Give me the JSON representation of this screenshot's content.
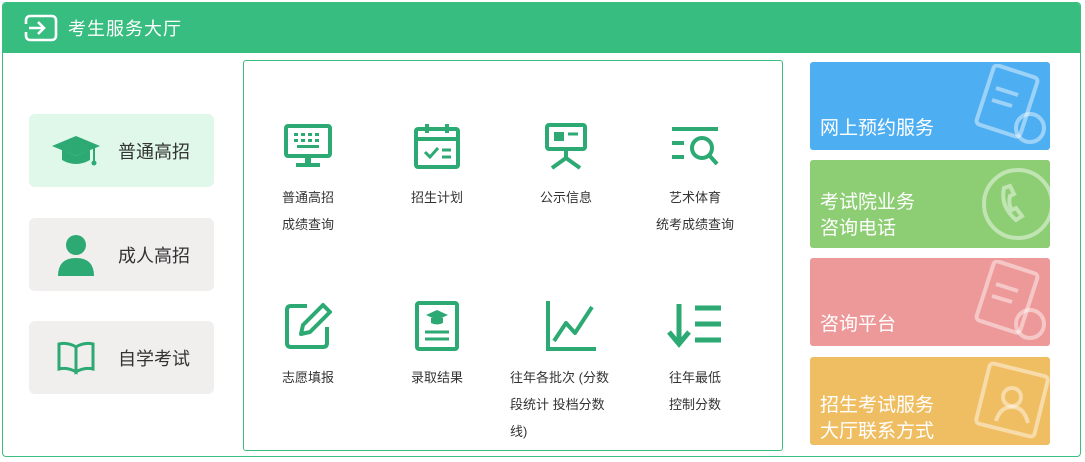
{
  "header": {
    "title": "考生服务大厅",
    "icon": "exit-icon"
  },
  "sidebar": {
    "items": [
      {
        "label": "普通高招",
        "icon": "graduation-cap-icon",
        "active": true
      },
      {
        "label": "成人高招",
        "icon": "person-icon",
        "active": false
      },
      {
        "label": "自学考试",
        "icon": "book-icon",
        "active": false
      }
    ]
  },
  "services": [
    {
      "line1": "普通高招",
      "line2": "成绩查询",
      "icon": "monitor-keyboard-icon"
    },
    {
      "line1": "招生计划",
      "line2": "",
      "icon": "calendar-check-icon"
    },
    {
      "line1": "公示信息",
      "line2": "",
      "icon": "presentation-board-icon"
    },
    {
      "line1": "艺术体育",
      "line2": "统考成绩查询",
      "icon": "list-search-icon"
    },
    {
      "line1": "志愿填报",
      "line2": "",
      "icon": "edit-form-icon"
    },
    {
      "line1": "录取结果",
      "line2": "",
      "icon": "certificate-icon"
    },
    {
      "line1": "往年各批次 (分数",
      "line2": "段统计 投档分数",
      "line3": "线)",
      "icon": "line-chart-icon"
    },
    {
      "line1": "往年最低",
      "line2": "控制分数",
      "icon": "sort-down-list-icon"
    }
  ],
  "cards": [
    {
      "line1": "网上预约服务",
      "line2": "",
      "color": "#4eaef2",
      "icon": "document-search-icon"
    },
    {
      "line1": "考试院业务",
      "line2": "咨询电话",
      "color": "#8dce74",
      "icon": "phone-icon"
    },
    {
      "line1": "咨询平台",
      "line2": "",
      "color": "#ee9999",
      "icon": "document-search-icon"
    },
    {
      "line1": "招生考试服务",
      "line2": "大厅联系方式",
      "color": "#f0be62",
      "icon": "contact-card-icon"
    }
  ],
  "colors": {
    "brand": "#37bd7f",
    "icon_green": "#2daa73"
  }
}
